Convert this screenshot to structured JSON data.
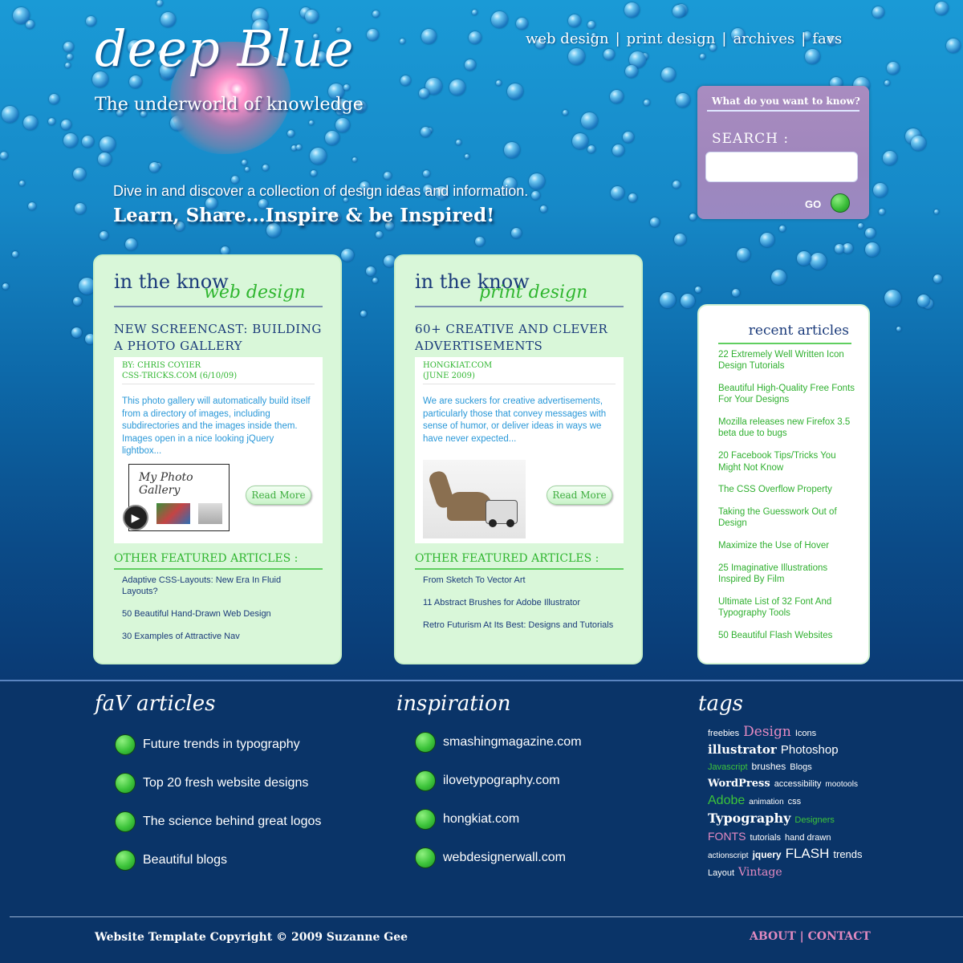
{
  "header": {
    "logo": "deep Blue",
    "tagline": "The underworld of knowledge",
    "nav": [
      "web design",
      "print design",
      "archives",
      "favs"
    ],
    "nav_separator": "|",
    "intro_line1": "Dive in and discover a collection of design ideas and information.",
    "intro_line2": "Learn,  Share...Inspire & be Inspired!"
  },
  "search": {
    "question": "What do you want to know?",
    "label": "SEARCH :",
    "value": "",
    "go_label": "GO"
  },
  "cards": [
    {
      "heading": "in the know",
      "subheading": "web design",
      "title": "NEW SCREENCAST: BUILDING A PHOTO GALLERY",
      "byline": "BY: CHRIS COYIER",
      "source": "CSS-TRICKS.COM (6/10/09)",
      "description": "This photo gallery will automatically build itself from a directory of images, including subdirectories and the images  inside them. Images open in a nice looking jQuery lightbox...",
      "thumb_title": "My Photo Gallery",
      "read_more": "Read More",
      "other_heading": "OTHER FEATURED ARTICLES :",
      "other": [
        "Adaptive CSS-Layouts: New Era In Fluid Layouts?",
        "50 Beautiful Hand-Drawn Web Design",
        "30 Examples of Attractive Nav"
      ]
    },
    {
      "heading": "in the know",
      "subheading": "print design",
      "title": "60+ CREATIVE AND CLEVER ADVERTISEMENTS",
      "byline": "HONGKIAT.COM",
      "source": "(JUNE 2009)",
      "description": "We are suckers for creative advertisements, particularly those that convey messages with sense of humor, or deliver ideas in ways we have never expected...",
      "read_more": "Read More",
      "other_heading": "OTHER FEATURED ARTICLES :",
      "other": [
        "From Sketch To Vector Art",
        "11 Abstract Brushes for Adobe Illustrator",
        "Retro Futurism At Its Best: Designs and Tutorials"
      ]
    }
  ],
  "recent": {
    "heading": "recent articles",
    "items": [
      "22 Extremely Well Written Icon Design Tutorials",
      "Beautiful High-Quality Free Fonts For Your Designs",
      "Mozilla releases new Firefox 3.5 beta due to bugs",
      "20 Facebook Tips/Tricks You Might Not Know",
      "The CSS Overflow Property",
      "Taking the Guesswork Out of Design",
      "Maximize the Use of Hover",
      "25 Imaginative Illustrations Inspired By Film",
      "Ultimate List of 32 Font And Typography Tools",
      "50 Beautiful Flash Websites"
    ]
  },
  "fav": {
    "heading": "faV articles",
    "items": [
      "Future trends in typography",
      "Top 20 fresh website designs",
      "The science behind great logos",
      "Beautiful blogs"
    ]
  },
  "inspiration": {
    "heading": "inspiration",
    "items": [
      "smashingmagazine.com",
      "ilovetypography.com",
      "hongkiat.com",
      "webdesignerwall.com"
    ]
  },
  "tags": {
    "heading": "tags",
    "items": [
      {
        "t": "freebies",
        "c": "#ffffff"
      },
      {
        "t": "Design",
        "c": "#e58ac2"
      },
      {
        "t": "Icons",
        "c": "#ffffff"
      },
      {
        "t": "illustrator",
        "c": "#ffffff"
      },
      {
        "t": "Photoshop",
        "c": "#ffffff"
      },
      {
        "t": "Javascript",
        "c": "#3cc43a"
      },
      {
        "t": "brushes",
        "c": "#ffffff"
      },
      {
        "t": "Blogs",
        "c": "#ffffff"
      },
      {
        "t": "WordPress",
        "c": "#ffffff"
      },
      {
        "t": "accessibility",
        "c": "#ffffff"
      },
      {
        "t": "mootools",
        "c": "#ffffff"
      },
      {
        "t": "Adobe",
        "c": "#3cc43a"
      },
      {
        "t": "animation",
        "c": "#ffffff"
      },
      {
        "t": "css",
        "c": "#ffffff"
      },
      {
        "t": "Typography",
        "c": "#ffffff"
      },
      {
        "t": "Designers",
        "c": "#3cc43a"
      },
      {
        "t": "FONTS",
        "c": "#e58ac2"
      },
      {
        "t": "tutorials",
        "c": "#ffffff"
      },
      {
        "t": "hand drawn",
        "c": "#ffffff"
      },
      {
        "t": "actionscript",
        "c": "#ffffff"
      },
      {
        "t": "jquery",
        "c": "#ffffff"
      },
      {
        "t": "FLASH",
        "c": "#ffffff"
      },
      {
        "t": "trends",
        "c": "#ffffff"
      },
      {
        "t": "Layout",
        "c": "#ffffff"
      },
      {
        "t": "Vintage",
        "c": "#e58ac2"
      }
    ]
  },
  "footer": {
    "copyright": "Website Template Copyright © 2009 Suzanne Gee",
    "about": "ABOUT",
    "separator": "|",
    "contact": "CONTACT"
  }
}
